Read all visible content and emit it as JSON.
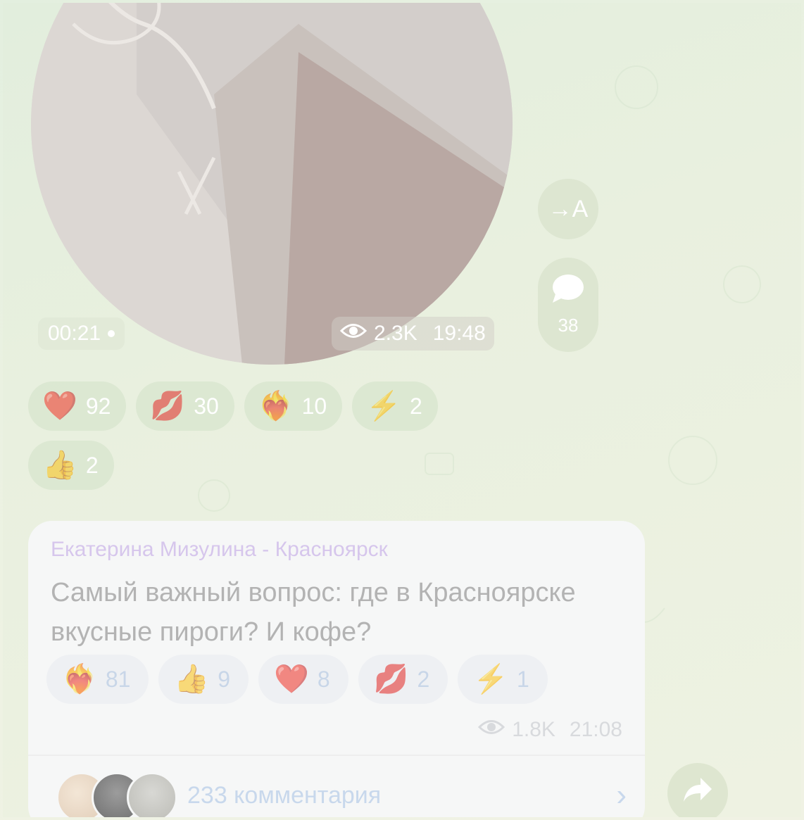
{
  "video": {
    "duration": "00:21",
    "views": "2.3K",
    "time": "19:48"
  },
  "side_buttons": {
    "translate_label": "→A",
    "comments_count": "38"
  },
  "reactions": [
    {
      "emoji": "❤️",
      "count": "92"
    },
    {
      "emoji": "💋",
      "count": "30"
    },
    {
      "emoji": "❤️‍🔥",
      "count": "10"
    },
    {
      "emoji": "⚡",
      "count": "2"
    },
    {
      "emoji": "👍",
      "count": "2"
    }
  ],
  "post": {
    "author": "Екатерина Мизулина - Красноярск",
    "text": "Самый важный вопрос: где в Красноярске вкусные пироги? И кофе?",
    "reactions": [
      {
        "emoji": "❤️‍🔥",
        "count": "81"
      },
      {
        "emoji": "👍",
        "count": "9"
      },
      {
        "emoji": "❤️",
        "count": "8"
      },
      {
        "emoji": "💋",
        "count": "2"
      },
      {
        "emoji": "⚡",
        "count": "1"
      }
    ],
    "views": "1.8K",
    "time": "21:08",
    "comments_label": "233 комментария"
  }
}
